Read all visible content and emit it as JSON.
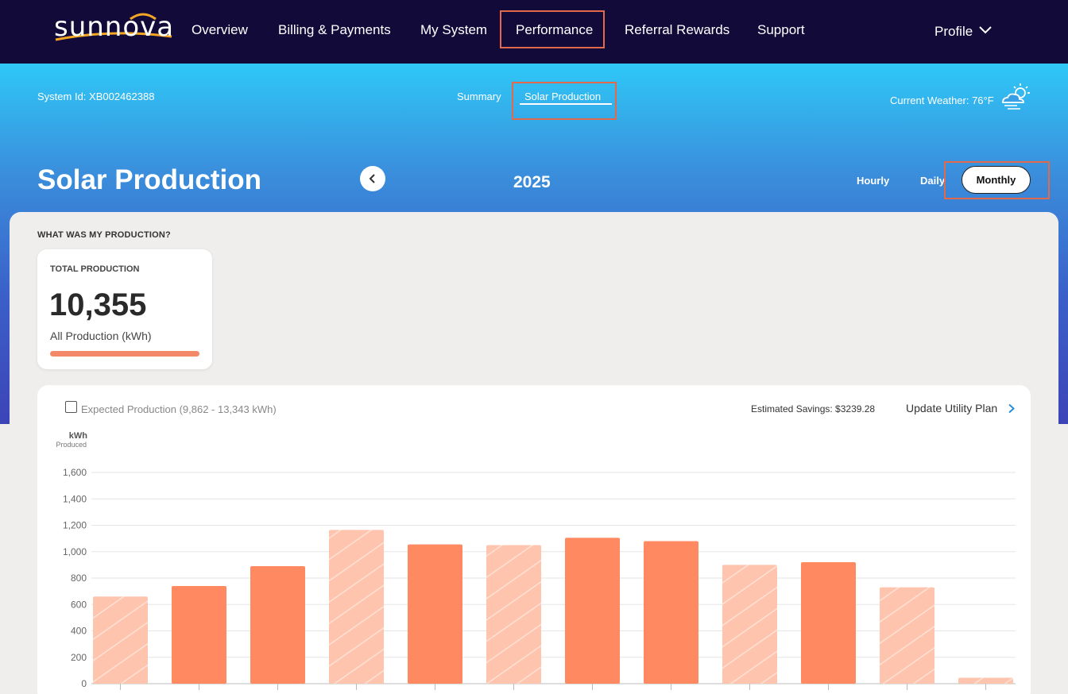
{
  "nav": {
    "logo_text": "sunnova",
    "items": [
      "Overview",
      "Billing & Payments",
      "My System",
      "Performance",
      "Referral Rewards",
      "Support"
    ],
    "profile": "Profile"
  },
  "header": {
    "system_id": "System Id: XB002462388",
    "tabs": [
      "Summary",
      "Solar Production"
    ],
    "weather": "Current Weather: 76°F"
  },
  "title": "Solar Production",
  "year": "2025",
  "ranges": [
    "Hourly",
    "Daily",
    "Monthly"
  ],
  "section_label": "WHAT WAS MY PRODUCTION?",
  "total": {
    "label": "TOTAL PRODUCTION",
    "value": "10,355",
    "sub": "All Production (kWh)"
  },
  "chart_controls": {
    "expected_label": "Expected Production (9,862 - 13,343 kWh)",
    "savings": "Estimated Savings: $3239.28",
    "update_plan": "Update Utility Plan"
  },
  "colors": {
    "bar_solid": "#ff8a62",
    "bar_hatched": "#ffc4ad",
    "accent_outline": "#e2694a"
  },
  "chart_data": {
    "type": "bar",
    "ylabel": "kWh",
    "ylabel_sub": "Produced",
    "ylim": [
      0,
      1600
    ],
    "yticks": [
      0,
      200,
      400,
      600,
      800,
      1000,
      1200,
      1400,
      1600
    ],
    "grid": true,
    "values": [
      660,
      740,
      890,
      1165,
      1055,
      1050,
      1105,
      1080,
      900,
      920,
      730,
      45
    ],
    "styles": [
      "hatched",
      "solid",
      "solid",
      "hatched",
      "solid",
      "hatched",
      "solid",
      "solid",
      "hatched",
      "solid",
      "hatched",
      "hatched"
    ]
  }
}
